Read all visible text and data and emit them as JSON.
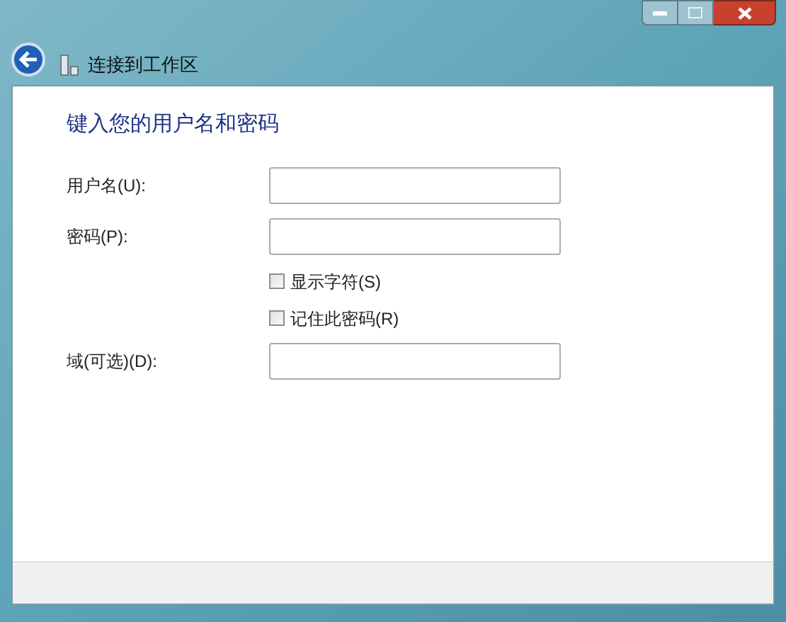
{
  "window": {
    "title": "连接到工作区"
  },
  "heading": "键入您的用户名和密码",
  "fields": [
    {
      "label": "用户名(U):"
    },
    {
      "label": "密码(P):"
    }
  ],
  "checkboxes": [
    {
      "label": "显示字符(S)",
      "checked": false
    },
    {
      "label": "记住此密码(R)",
      "checked": false
    }
  ],
  "domain_field": {
    "label": "域(可选)(D):"
  }
}
